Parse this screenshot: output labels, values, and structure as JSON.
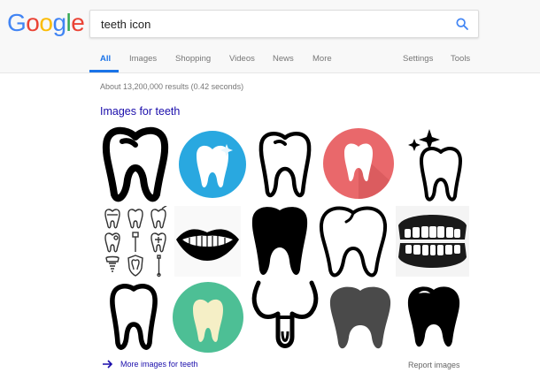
{
  "logo": {
    "letters": [
      "G",
      "o",
      "o",
      "g",
      "l",
      "e"
    ],
    "colors": [
      "#4285f4",
      "#ea4335",
      "#fbbc05",
      "#4285f4",
      "#34a853",
      "#ea4335"
    ]
  },
  "search": {
    "query": "teeth icon"
  },
  "tabs": [
    {
      "label": "All",
      "active": true
    },
    {
      "label": "Images"
    },
    {
      "label": "Shopping"
    },
    {
      "label": "Videos"
    },
    {
      "label": "News"
    },
    {
      "label": "More"
    },
    {
      "label": "Settings"
    },
    {
      "label": "Tools"
    }
  ],
  "results": {
    "stats": "About 13,200,000 results (0.42 seconds)"
  },
  "images_section": {
    "title": "Images for teeth",
    "more_label": "More images for teeth",
    "report_label": "Report images",
    "thumbnails": [
      "tooth-outline-icon",
      "tooth-blue-circle-icon",
      "tooth-thin-outline-icon",
      "tooth-red-circle-icon",
      "sparkling-tooth-icon",
      "dental-icons-set",
      "smiling-lips-icon",
      "tooth-black-silhouette-icon",
      "tooth-white-outline-icon",
      "dentures-icon",
      "tooth-outline-icon",
      "tooth-green-circle-icon",
      "tooth-root-outline-icon",
      "tooth-gray-silhouette-icon",
      "tooth-black-shine-icon"
    ]
  },
  "colors": {
    "accent": "#1a73e8",
    "link": "#1a0dab",
    "blue_circle": "#29a8e0",
    "red_circle": "#e9686b",
    "green_circle": "#4dbf95",
    "gray_tooth": "#4a4a4a"
  }
}
